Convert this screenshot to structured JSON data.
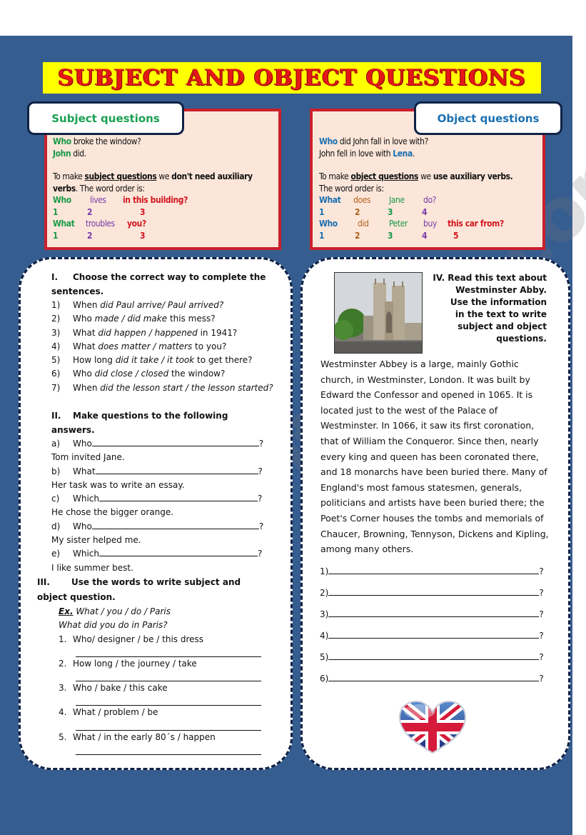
{
  "title": "SUBJECT AND OBJECT QUESTIONS",
  "colors": {
    "background": "#365d8f",
    "title_bg": "#ffff00",
    "title_text": "#e41818",
    "info_box_bg": "#fce6da",
    "info_box_border": "#c9202e"
  },
  "subject_box": {
    "label": "Subject questions",
    "example_q_word": "Who",
    "example_q_rest": " broke the window?",
    "example_a_word": "John",
    "example_a_rest": " did.",
    "rule_pre": "To make ",
    "rule_key": "subject questions",
    "rule_mid": " we ",
    "rule_bold": "don't need auxiliary verbs",
    "rule_post": ". The word order is:",
    "order1": [
      "Who",
      "lives",
      "in this building?"
    ],
    "order1_nums": [
      "1",
      "2",
      "3"
    ],
    "order2": [
      "What",
      "troubles",
      "you?"
    ],
    "order2_nums": [
      "1",
      "2",
      "3"
    ]
  },
  "object_box": {
    "label": "Object questions",
    "example_q_word": "Who",
    "example_q_rest": " did John fall in love with?",
    "example_a_pre": "John fell in love with ",
    "example_a_word": "Lena",
    "example_a_post": ".",
    "rule_pre": "To make ",
    "rule_key": "object questions",
    "rule_mid": " we ",
    "rule_bold": "use auxiliary verbs.",
    "rule_post": "The word order is:",
    "order1": [
      "What",
      "does",
      "Jane",
      "do?"
    ],
    "order1_nums": [
      "1",
      "2",
      "3",
      "4"
    ],
    "order2": [
      "Who",
      "did",
      "Peter",
      "buy",
      "this car from?"
    ],
    "order2_nums": [
      "1",
      "2",
      "3",
      "4",
      "5"
    ]
  },
  "section1": {
    "num": "I.",
    "title": "Choose the correct way to complete the sentences.",
    "items": [
      {
        "n": "1)",
        "pre": "When ",
        "opt": "did Paul arrive/ Paul arrived?",
        "post": ""
      },
      {
        "n": "2)",
        "pre": "Who ",
        "opt": "made / did make",
        "post": " this mess?"
      },
      {
        "n": "3)",
        "pre": "What ",
        "opt": "did happen / happened",
        "post": " in 1941?"
      },
      {
        "n": "4)",
        "pre": "What ",
        "opt": "does matter / matters",
        "post": " to you?"
      },
      {
        "n": "5)",
        "pre": "How long ",
        "opt": "did it take / it took",
        "post": " to get there?"
      },
      {
        "n": "6)",
        "pre": "Who ",
        "opt": "did close / closed",
        "post": " the window?"
      },
      {
        "n": "7)",
        "pre": "When ",
        "opt": "did the lesson start / the lesson started?",
        "post": ""
      }
    ]
  },
  "section2": {
    "num": "II.",
    "title": "Make questions to the following answers.",
    "items": [
      {
        "n": "a)",
        "start": "Who",
        "answer": "Tom invited Jane."
      },
      {
        "n": "b)",
        "start": "What",
        "answer": "Her task was to write an essay."
      },
      {
        "n": "c)",
        "start": "Which",
        "answer": "He chose the bigger orange."
      },
      {
        "n": "d)",
        "start": "Who",
        "answer": "My sister helped me."
      },
      {
        "n": "e)",
        "start": "Which",
        "answer": "I like summer best."
      }
    ]
  },
  "section3": {
    "num": "III.",
    "title": "Use the words to write subject and object question.",
    "ex_label": "Ex.",
    "ex_prompt": " What / you / do / Paris",
    "ex_answer": "What did you do in Paris?",
    "items": [
      {
        "n": "1.",
        "text": "Who/ designer / be / this dress"
      },
      {
        "n": "2.",
        "text": "How long / the journey / take"
      },
      {
        "n": "3.",
        "text": "Who / bake / this cake"
      },
      {
        "n": "4.",
        "text": "What / problem / be"
      },
      {
        "n": "5.",
        "text": "What / in the early 80´s / happen"
      }
    ]
  },
  "section4": {
    "title_lines": [
      "IV. Read this text about",
      "Westminster Abby.",
      "Use the information",
      "in the text to write",
      "subject and object questions."
    ],
    "photo_alt": "Westminster Abbey photo",
    "text": "Westminster Abbey is a large, mainly Gothic church, in Westminster, London. It was built by Edward the Confessor and opened in 1065. It is located just to the west of the Palace of Westminster. In 1066, it saw its first coronation, that of William the Conqueror. Since then, nearly every king and queen has been coronated there, and 18 monarchs have been buried there. Many of England's most famous statesmen, generals, politicians and artists have been buried there; the Poet's Corner houses the tombs and memorials of Chaucer, Browning, Tennyson, Dickens and Kipling, among many others.",
    "text_lines": [
      "Westminster Abbey is a large, mainly Gothic",
      "church, in Westminster, London. It was built by",
      "Edward the Confessor and opened in 1065. It is",
      "located just to the west of the Palace of",
      "Westminster. In 1066, it saw its first coronation,",
      "that of William the Conqueror. Since then, nearly",
      "every king and queen has been coronated there,",
      "and 18 monarchs have been buried there. Many of",
      "England's most famous statesmen, generals,",
      "politicians and artists have been buried there; the",
      "Poet's Corner houses the tombs and memorials of",
      "Chaucer, Browning, Tennyson, Dickens and Kipling,",
      "among many others."
    ],
    "answers": [
      "1)",
      "2)",
      "3)",
      "4)",
      "5)",
      "6)"
    ],
    "qmark": "?"
  },
  "watermark": "ESLprintables.com",
  "decoration": "union-jack-heart"
}
